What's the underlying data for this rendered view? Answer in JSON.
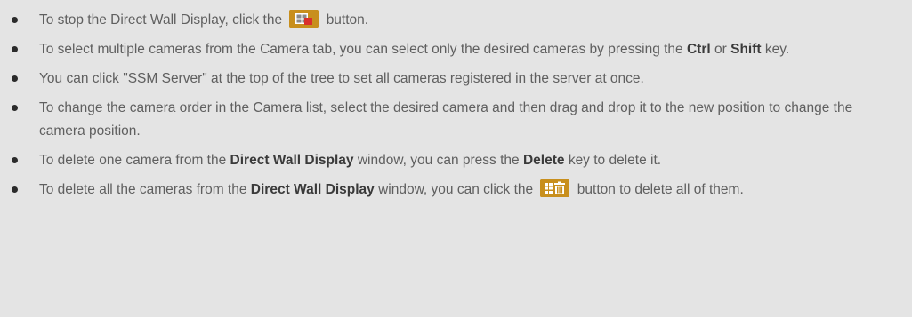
{
  "items": [
    {
      "pre": "To stop the Direct Wall Display, click the",
      "icon": "stop-wall-display-icon",
      "post": "button."
    },
    {
      "t1": "To select multiple cameras from the Camera tab, you can select only the desired cameras by pressing the",
      "b1": "Ctrl",
      "t2": "or",
      "b2": "Shift",
      "t3": "key."
    },
    {
      "text": "You can click \"SSM Server\" at the top of the tree to set all cameras registered in the server at once."
    },
    {
      "text": "To change the camera order in the Camera list, select the desired camera and then drag and drop it to the new position to change the camera position."
    },
    {
      "t1": "To delete one camera from the",
      "b1": "Direct Wall Display",
      "t2": "window, you can press the",
      "b2": "Delete",
      "t3": "key to delete it."
    },
    {
      "t1": "To delete all the cameras from the",
      "b1": "Direct Wall Display",
      "t2": "window, you can click the",
      "icon": "delete-all-cameras-icon",
      "t3": "button to delete all of them."
    }
  ],
  "colors": {
    "background": "#e4e4e4",
    "text": "#5f5f5f",
    "bullet": "#2b2b2b",
    "button": "#c88f1d"
  }
}
